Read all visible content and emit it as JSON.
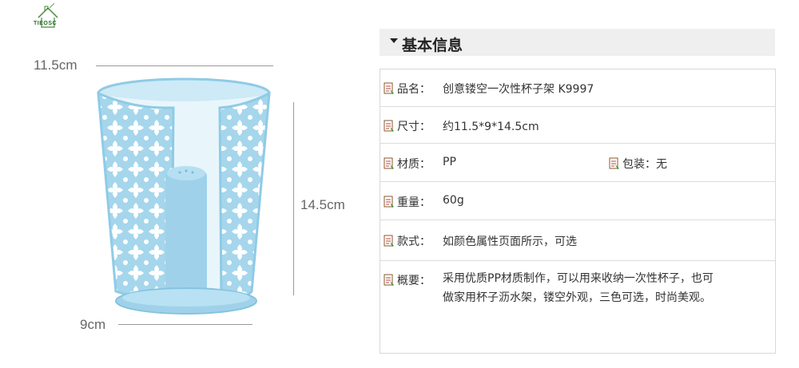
{
  "logo": {
    "text": "TIEOSC"
  },
  "dimensions": {
    "top_width": "11.5cm",
    "height": "14.5cm",
    "bottom_width": "9cm"
  },
  "product": {
    "color": "#a8d8ee",
    "name": "cup-holder-image"
  },
  "info": {
    "header": "基本信息",
    "rows": [
      {
        "label": "品名：",
        "value": "创意镂空一次性杯子架 K9997"
      },
      {
        "label": "尺寸：",
        "value": "约11.5*9*14.5cm"
      },
      {
        "label": "材质：",
        "value": "PP",
        "label2": "包装：",
        "value2": "无"
      },
      {
        "label": "重量：",
        "value": "60g"
      },
      {
        "label": "款式：",
        "value": "如颜色属性页面所示，可选"
      },
      {
        "label": "概要：",
        "value_line1": "采用优质PP材质制作，可以用来收纳一次性杯子，也可",
        "value_line2": "做家用杯子沥水架，镂空外观，三色可选，时尚美观。"
      }
    ]
  }
}
